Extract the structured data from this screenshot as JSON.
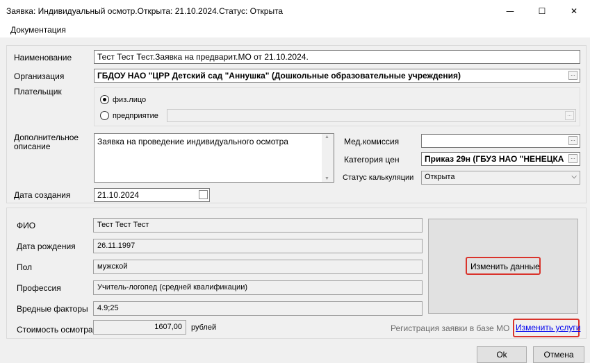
{
  "window": {
    "title": "Заявка: Индивидуальный осмотр.Открыта: 21.10.2024.Статус: Открыта",
    "minimize": "—",
    "maximize": "☐",
    "close": "✕"
  },
  "menu": {
    "items": [
      "Документация"
    ]
  },
  "form": {
    "name_label": "Наименование",
    "name_value": "Тест Тест Тест.Заявка на предварит.МО от 21.10.2024.",
    "org_label": "Организация",
    "org_value": "ГБДОУ НАО \"ЦРР  Детский сад \"Аннушка\" (Дошкольные образовательные учреждения)",
    "payer_label": "Плательщик",
    "payer_options": [
      "физ.лицо",
      "предприятие"
    ],
    "payer_selected": "физ.лицо",
    "desc_label": "Дополнительное описание",
    "desc_value": "Заявка на проведение индивидуального осмотра",
    "medcom_label": "Мед.комиссия",
    "medcom_value": "",
    "price_cat_label": "Категория цен",
    "price_cat_value": "Приказ 29н (ГБУЗ НАО \"НЕНЕЦКА",
    "calc_status_label": "Статус калькуляции",
    "calc_status_value": "Открыта",
    "created_label": "Дата создания",
    "created_value": "21.10.2024",
    "ellipsis": "...",
    "scroll_up": "▲",
    "scroll_down": "▼",
    "dropdown_caret": "⌵"
  },
  "person": {
    "fio_label": "ФИО",
    "fio_value": "Тест Тест Тест",
    "birth_label": "Дата рождения",
    "birth_value": "26.11.1997",
    "gender_label": "Пол",
    "gender_value": "мужской",
    "profession_label": "Профессия",
    "profession_value": "Учитель-логопед (средней квалификации)",
    "hazards_label": "Вредные факторы",
    "hazards_value": "4.9;25",
    "cost_label": "Стоимость осмотра",
    "cost_value": "1607,00",
    "cost_unit": "рублей",
    "change_data_button": "Изменить данные",
    "registration_text": "Регистрация заявки в базе МО",
    "change_services_link": "Изменить услуги"
  },
  "footer": {
    "ok": "Ok",
    "cancel": "Отмена"
  },
  "colors": {
    "highlight": "#d9332b",
    "link": "#0000ee"
  }
}
